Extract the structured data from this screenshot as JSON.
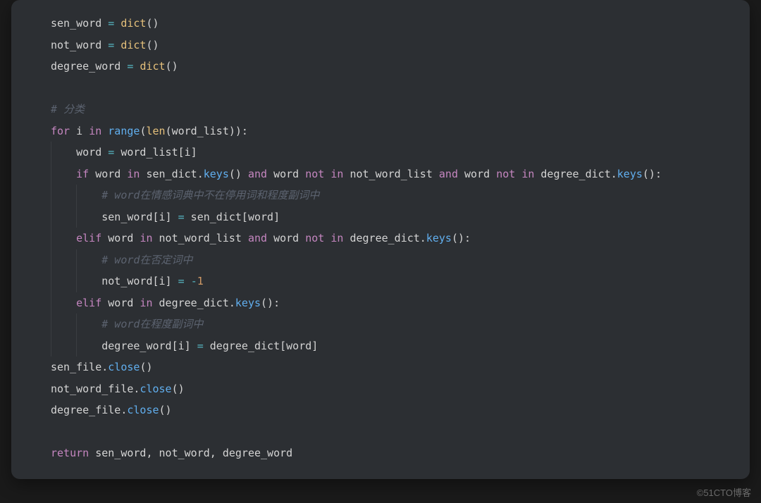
{
  "watermark": "©51CTO博客",
  "code": {
    "lines": [
      {
        "indent": 1,
        "tokens": [
          {
            "t": "sen_word ",
            "c": "var"
          },
          {
            "t": "=",
            "c": "op"
          },
          {
            "t": " ",
            "c": "var"
          },
          {
            "t": "dict",
            "c": "builtin"
          },
          {
            "t": "()",
            "c": "paren"
          }
        ]
      },
      {
        "indent": 1,
        "tokens": [
          {
            "t": "not_word ",
            "c": "var"
          },
          {
            "t": "=",
            "c": "op"
          },
          {
            "t": " ",
            "c": "var"
          },
          {
            "t": "dict",
            "c": "builtin"
          },
          {
            "t": "()",
            "c": "paren"
          }
        ]
      },
      {
        "indent": 1,
        "tokens": [
          {
            "t": "degree_word ",
            "c": "var"
          },
          {
            "t": "=",
            "c": "op"
          },
          {
            "t": " ",
            "c": "var"
          },
          {
            "t": "dict",
            "c": "builtin"
          },
          {
            "t": "()",
            "c": "paren"
          }
        ]
      },
      {
        "indent": 1,
        "tokens": []
      },
      {
        "indent": 1,
        "tokens": [
          {
            "t": "# 分类",
            "c": "comment"
          }
        ]
      },
      {
        "indent": 1,
        "tokens": [
          {
            "t": "for",
            "c": "kw"
          },
          {
            "t": " i ",
            "c": "var"
          },
          {
            "t": "in",
            "c": "kw"
          },
          {
            "t": " ",
            "c": "var"
          },
          {
            "t": "range",
            "c": "fn"
          },
          {
            "t": "(",
            "c": "paren"
          },
          {
            "t": "len",
            "c": "builtin"
          },
          {
            "t": "(word_list)):",
            "c": "paren"
          }
        ]
      },
      {
        "indent": 2,
        "tokens": [
          {
            "t": "word ",
            "c": "var"
          },
          {
            "t": "=",
            "c": "op"
          },
          {
            "t": " word_list[i]",
            "c": "var"
          }
        ]
      },
      {
        "indent": 2,
        "tokens": [
          {
            "t": "if",
            "c": "kw"
          },
          {
            "t": " word ",
            "c": "var"
          },
          {
            "t": "in",
            "c": "kw"
          },
          {
            "t": " sen_dict.",
            "c": "var"
          },
          {
            "t": "keys",
            "c": "method"
          },
          {
            "t": "() ",
            "c": "paren"
          },
          {
            "t": "and",
            "c": "kw"
          },
          {
            "t": " word ",
            "c": "var"
          },
          {
            "t": "not",
            "c": "kw"
          },
          {
            "t": " ",
            "c": "var"
          },
          {
            "t": "in",
            "c": "kw"
          },
          {
            "t": " not_word_list ",
            "c": "var"
          },
          {
            "t": "and",
            "c": "kw"
          },
          {
            "t": " word ",
            "c": "var"
          },
          {
            "t": "not",
            "c": "kw"
          },
          {
            "t": " ",
            "c": "var"
          },
          {
            "t": "in",
            "c": "kw"
          },
          {
            "t": " degree_dict.",
            "c": "var"
          },
          {
            "t": "keys",
            "c": "method"
          },
          {
            "t": "():",
            "c": "paren"
          }
        ]
      },
      {
        "indent": 3,
        "tokens": [
          {
            "t": "# word在情感词典中不在停用词和程度副词中",
            "c": "comment"
          }
        ]
      },
      {
        "indent": 3,
        "tokens": [
          {
            "t": "sen_word[i] ",
            "c": "var"
          },
          {
            "t": "=",
            "c": "op"
          },
          {
            "t": " sen_dict[word]",
            "c": "var"
          }
        ]
      },
      {
        "indent": 2,
        "tokens": [
          {
            "t": "elif",
            "c": "kw"
          },
          {
            "t": " word ",
            "c": "var"
          },
          {
            "t": "in",
            "c": "kw"
          },
          {
            "t": " not_word_list ",
            "c": "var"
          },
          {
            "t": "and",
            "c": "kw"
          },
          {
            "t": " word ",
            "c": "var"
          },
          {
            "t": "not",
            "c": "kw"
          },
          {
            "t": " ",
            "c": "var"
          },
          {
            "t": "in",
            "c": "kw"
          },
          {
            "t": " degree_dict.",
            "c": "var"
          },
          {
            "t": "keys",
            "c": "method"
          },
          {
            "t": "():",
            "c": "paren"
          }
        ]
      },
      {
        "indent": 3,
        "tokens": [
          {
            "t": "# word在否定词中",
            "c": "comment"
          }
        ]
      },
      {
        "indent": 3,
        "tokens": [
          {
            "t": "not_word[i] ",
            "c": "var"
          },
          {
            "t": "=",
            "c": "op"
          },
          {
            "t": " ",
            "c": "var"
          },
          {
            "t": "-",
            "c": "op"
          },
          {
            "t": "1",
            "c": "num"
          }
        ]
      },
      {
        "indent": 2,
        "tokens": [
          {
            "t": "elif",
            "c": "kw"
          },
          {
            "t": " word ",
            "c": "var"
          },
          {
            "t": "in",
            "c": "kw"
          },
          {
            "t": " degree_dict.",
            "c": "var"
          },
          {
            "t": "keys",
            "c": "method"
          },
          {
            "t": "():",
            "c": "paren"
          }
        ]
      },
      {
        "indent": 3,
        "tokens": [
          {
            "t": "# word在程度副词中",
            "c": "comment"
          }
        ]
      },
      {
        "indent": 3,
        "tokens": [
          {
            "t": "degree_word[i] ",
            "c": "var"
          },
          {
            "t": "=",
            "c": "op"
          },
          {
            "t": " degree_dict[word]",
            "c": "var"
          }
        ]
      },
      {
        "indent": 1,
        "tokens": [
          {
            "t": "sen_file.",
            "c": "var"
          },
          {
            "t": "close",
            "c": "method"
          },
          {
            "t": "()",
            "c": "paren"
          }
        ]
      },
      {
        "indent": 1,
        "tokens": [
          {
            "t": "not_word_file.",
            "c": "var"
          },
          {
            "t": "close",
            "c": "method"
          },
          {
            "t": "()",
            "c": "paren"
          }
        ]
      },
      {
        "indent": 1,
        "tokens": [
          {
            "t": "degree_file.",
            "c": "var"
          },
          {
            "t": "close",
            "c": "method"
          },
          {
            "t": "()",
            "c": "paren"
          }
        ]
      },
      {
        "indent": 1,
        "tokens": []
      },
      {
        "indent": 1,
        "tokens": [
          {
            "t": "return",
            "c": "ret"
          },
          {
            "t": " sen_word, not_word, degree_word",
            "c": "var"
          }
        ]
      }
    ]
  }
}
